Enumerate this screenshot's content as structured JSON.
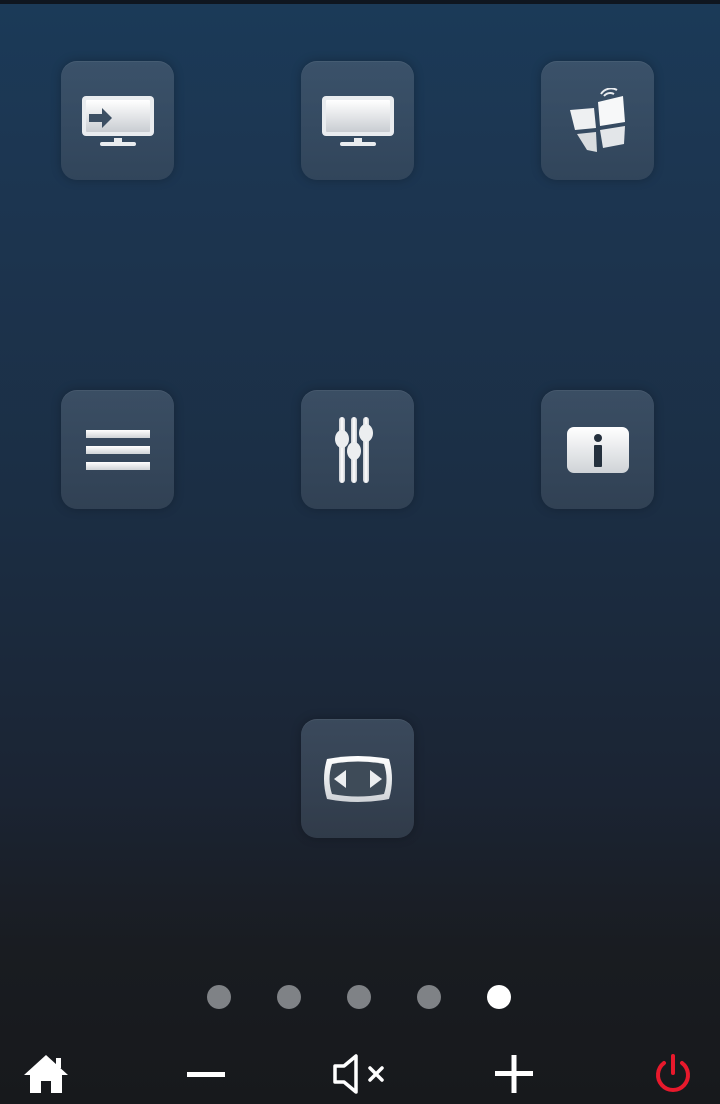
{
  "tiles": [
    {
      "name": "input-source-tile",
      "icon": "tv-input-icon"
    },
    {
      "name": "tv-tile",
      "icon": "tv-icon"
    },
    {
      "name": "smart-hub-tile",
      "icon": "smart-hub-icon"
    },
    {
      "name": "menu-tile",
      "icon": "menu-icon"
    },
    {
      "name": "settings-tile",
      "icon": "equalizer-icon"
    },
    {
      "name": "info-tile",
      "icon": "info-icon"
    },
    {
      "name": "aspect-ratio-tile",
      "icon": "aspect-ratio-icon"
    }
  ],
  "pagination": {
    "page_count": 5,
    "active_page": 5
  },
  "bottom_bar": {
    "buttons": [
      "home-icon",
      "volume-down-icon",
      "mute-icon",
      "volume-up-icon",
      "power-icon"
    ],
    "power_color": "#e8192c",
    "icon_color": "#ffffff"
  },
  "colors": {
    "dot_inactive": "#7f8286",
    "dot_active": "#ffffff"
  }
}
